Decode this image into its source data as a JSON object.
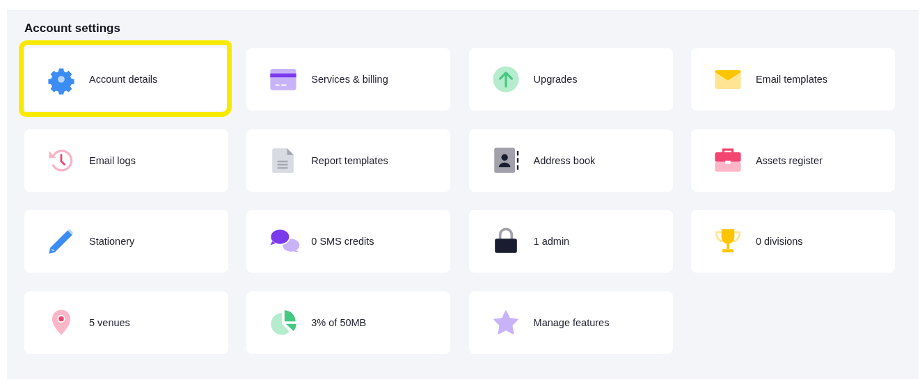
{
  "section": {
    "title": "Account settings"
  },
  "items": [
    {
      "label": "Account details",
      "highlighted": true
    },
    {
      "label": "Services & billing",
      "highlighted": false
    },
    {
      "label": "Upgrades",
      "highlighted": false
    },
    {
      "label": "Email templates",
      "highlighted": false
    },
    {
      "label": "Email logs",
      "highlighted": false
    },
    {
      "label": "Report templates",
      "highlighted": false
    },
    {
      "label": "Address book",
      "highlighted": false
    },
    {
      "label": "Assets register",
      "highlighted": false
    },
    {
      "label": "Stationery",
      "highlighted": false
    },
    {
      "label": "0 SMS credits",
      "highlighted": false
    },
    {
      "label": "1 admin",
      "highlighted": false
    },
    {
      "label": "0 divisions",
      "highlighted": false
    },
    {
      "label": "5 venues",
      "highlighted": false
    },
    {
      "label": "3% of 50MB",
      "highlighted": false
    },
    {
      "label": "Manage features",
      "highlighted": false
    }
  ]
}
